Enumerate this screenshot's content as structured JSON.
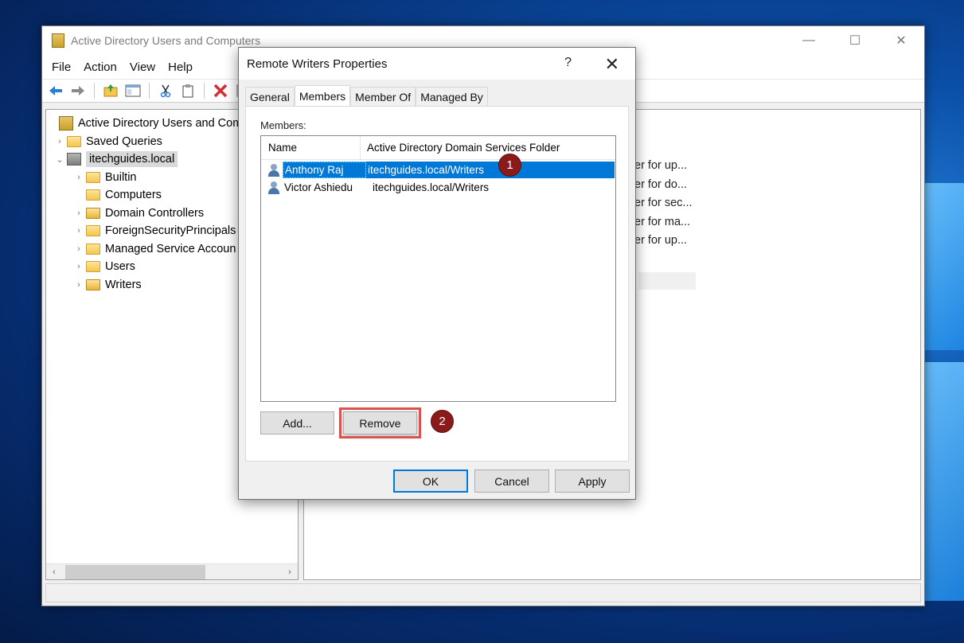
{
  "main_window": {
    "title": "Active Directory Users and Computers",
    "controls": {
      "minimize": "—",
      "maximize": "☐",
      "close": "✕"
    },
    "menu": [
      "File",
      "Action",
      "View",
      "Help"
    ],
    "toolbar_icons": [
      "back-arrow-icon",
      "forward-arrow-icon",
      "up-folder-icon",
      "show-console-tree-icon",
      "cut-icon",
      "copy-icon",
      "delete-icon",
      "properties-icon"
    ],
    "tree": {
      "root": "Active Directory Users and Comp",
      "saved_queries": "Saved Queries",
      "domain": "itechguides.local",
      "children": [
        "Builtin",
        "Computers",
        "Domain Controllers",
        "ForeignSecurityPrincipals",
        "Managed Service Accoun",
        "Users",
        "Writers"
      ]
    },
    "list_fragments": [
      "er for up...",
      "er for do...",
      "er for sec...",
      "er for ma...",
      "er for up..."
    ]
  },
  "dialog": {
    "title": "Remote Writers Properties",
    "help": "?",
    "close": "✕",
    "tabs": [
      "General",
      "Members",
      "Member Of",
      "Managed By"
    ],
    "active_tab": "Members",
    "members_label": "Members:",
    "columns": {
      "name": "Name",
      "folder": "Active Directory Domain Services Folder"
    },
    "members": [
      {
        "name": "Anthony Raj",
        "folder": "itechguides.local/Writers",
        "selected": true
      },
      {
        "name": "Victor Ashiedu",
        "folder": "itechguides.local/Writers",
        "selected": false
      }
    ],
    "buttons": {
      "add": "Add...",
      "remove": "Remove",
      "ok": "OK",
      "cancel": "Cancel",
      "apply": "Apply"
    },
    "annotations": {
      "step1": "1",
      "step2": "2"
    }
  },
  "colors": {
    "selection": "#0078d7",
    "annotation": "#8b1a1a",
    "highlight": "#d9534f"
  }
}
